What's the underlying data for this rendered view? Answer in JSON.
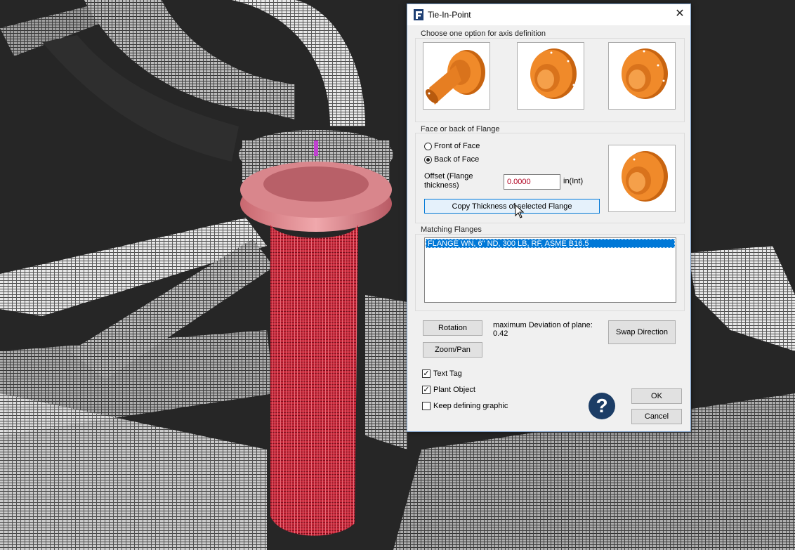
{
  "dialog": {
    "title": "Tie-In-Point",
    "close_label": "✕",
    "axis_group": {
      "label": "Choose one option for axis definition",
      "options": [
        "axis-option-pipe",
        "axis-option-face-points",
        "axis-option-rim-points"
      ]
    },
    "face_group": {
      "label": "Face or back of Flange",
      "front_label": "Front of Face",
      "back_label": "Back of Face",
      "selected": "Back of Face",
      "offset_label": "Offset (Flange thickness)",
      "offset_value": "0.0000",
      "offset_unit": "in(Int)",
      "copy_button": "Copy Thickness of selected Flange"
    },
    "matching_group": {
      "label": "Matching Flanges",
      "items": [
        "FLANGE WN, 6\" ND, 300 LB, RF, ASME B16.5"
      ]
    },
    "rotation_button": "Rotation",
    "zoom_button": "Zoom/Pan",
    "deviation_label": "maximum Deviation of plane:",
    "deviation_value": "0.42",
    "swap_button": "Swap Direction",
    "text_tag_label": "Text Tag",
    "text_tag_checked": true,
    "plant_object_label": "Plant Object",
    "plant_object_checked": true,
    "keep_graphic_label": "Keep defining graphic",
    "keep_graphic_checked": false,
    "help_label": "?",
    "ok_button": "OK",
    "cancel_button": "Cancel"
  },
  "colors": {
    "accent": "#0078d7",
    "flange_orange": "#e07a1f",
    "highlight_red": "#d0303a",
    "help_blue": "#1c3d66"
  }
}
